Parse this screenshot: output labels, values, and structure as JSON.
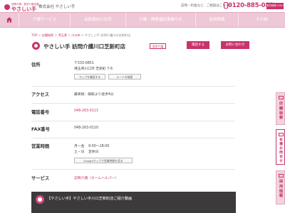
{
  "header": {
    "logo_small": "訪問介護・居宅介護支援",
    "logo_text": "やさしい手",
    "company": "株式会社 やさしい手",
    "note": "訪問・料金など、ご相談はこちらへ",
    "phone": "0120-885-082",
    "reception": "受付時間 9:00〜18:00"
  },
  "nav": {
    "items": [
      "介護サービス",
      "高齢者向け住宅",
      "介護・障害福祉事業の方",
      "採用情報",
      "その他"
    ]
  },
  "breadcrumb": [
    "TOP",
    "店舗検索",
    "埼玉県",
    "川口市",
    "やさしい手 訪問介護川口芝新町店"
  ],
  "store": {
    "title": "やさしい手 訪問介護川口芝新町店",
    "tag": "居宅介護",
    "phone_button": "電話する",
    "contact_button": "お問い合わせ"
  },
  "info": {
    "address_label": "住所",
    "postal": "〒333-0851",
    "address": "埼玉県川口市 芝新町 7-6",
    "map_button": "マップを確認する",
    "route_button": "ルートを検索",
    "access_label": "アクセス",
    "access": "最寄駅：蕨駅より徒歩4分",
    "tel_label": "電話番号",
    "tel": "048-263-0113",
    "fax_label": "FAX番号",
    "fax": "048-263-0110",
    "hours_label": "営業時間",
    "hours_days": "月〜金",
    "hours_time": "9:00〜18:00",
    "hours_closed": "土・日",
    "hours_closed_label": "定休日",
    "gmap_button": "Googleマップで営業時間を見る",
    "service_label": "サービス",
    "service": "訪問介護（ホームヘルパー）"
  },
  "video": {
    "title": "【やさしい手】やさしい手川口芝新町店ご紹介動画"
  },
  "side_tabs": [
    {
      "label": "店舗検索",
      "icon": "search-icon"
    },
    {
      "label": "各種お問合せ",
      "icon": "mail-icon"
    },
    {
      "label": "採用情報",
      "icon": "briefcase-icon"
    }
  ],
  "colors": {
    "accent": "#c8336b",
    "nav_bg": "#eec8d6"
  }
}
